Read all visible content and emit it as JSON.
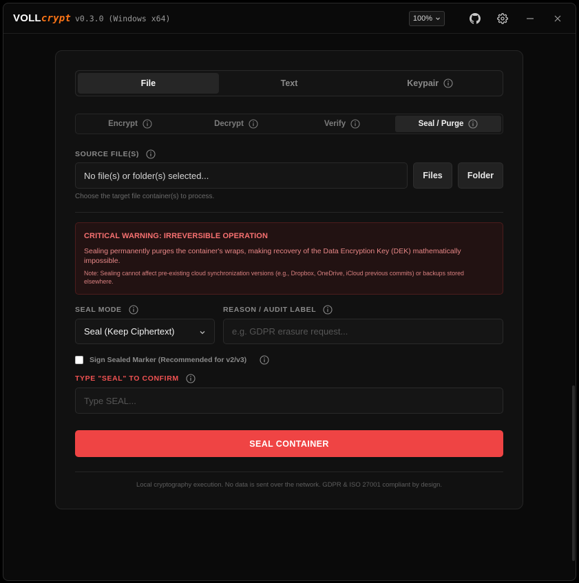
{
  "titlebar": {
    "brand_main": "VOLL",
    "brand_accent": "crypt",
    "version": "v0.3.0 (Windows x64)",
    "zoom": "100%",
    "github_icon": "github-icon",
    "settings_icon": "gear-icon",
    "minimize_icon": "minimize-icon",
    "close_icon": "close-icon"
  },
  "tabs": [
    {
      "label": "File",
      "active": true
    },
    {
      "label": "Text",
      "active": false
    },
    {
      "label": "Keypair",
      "active": false
    }
  ],
  "subtabs": [
    {
      "label": "Encrypt",
      "active": false
    },
    {
      "label": "Decrypt",
      "active": false
    },
    {
      "label": "Verify",
      "active": false
    },
    {
      "label": "Seal / Purge",
      "active": true
    }
  ],
  "source": {
    "label": "SOURCE FILE(S)",
    "value": "No file(s) or folder(s) selected...",
    "files_button": "Files",
    "folder_button": "Folder",
    "hint": "Choose the target file container(s) to process."
  },
  "warning": {
    "title": "CRITICAL WARNING: IRREVERSIBLE OPERATION",
    "body": "Sealing permanently purges the container's wraps, making recovery of the Data Encryption Key (DEK) mathematically impossible.",
    "note": "Note: Sealing cannot affect pre-existing cloud synchronization versions (e.g., Dropbox, OneDrive, iCloud previous commits) or backups stored elsewhere."
  },
  "seal_mode": {
    "label": "SEAL MODE",
    "selected": "Seal (Keep Ciphertext)"
  },
  "reason": {
    "label": "REASON / AUDIT LABEL",
    "placeholder": "e.g. GDPR erasure request..."
  },
  "sign_marker": {
    "label": "Sign Sealed Marker (Recommended for v2/v3)",
    "checked": false
  },
  "confirm": {
    "label": "TYPE \"SEAL\" TO CONFIRM",
    "placeholder": "Type SEAL..."
  },
  "seal_button": "SEAL CONTAINER",
  "footer": "Local cryptography execution. No data is sent over the network. GDPR & ISO 27001 compliant by design.",
  "colors": {
    "accent": "#f97316",
    "danger": "#ef4444",
    "background": "#0a0a0a"
  }
}
